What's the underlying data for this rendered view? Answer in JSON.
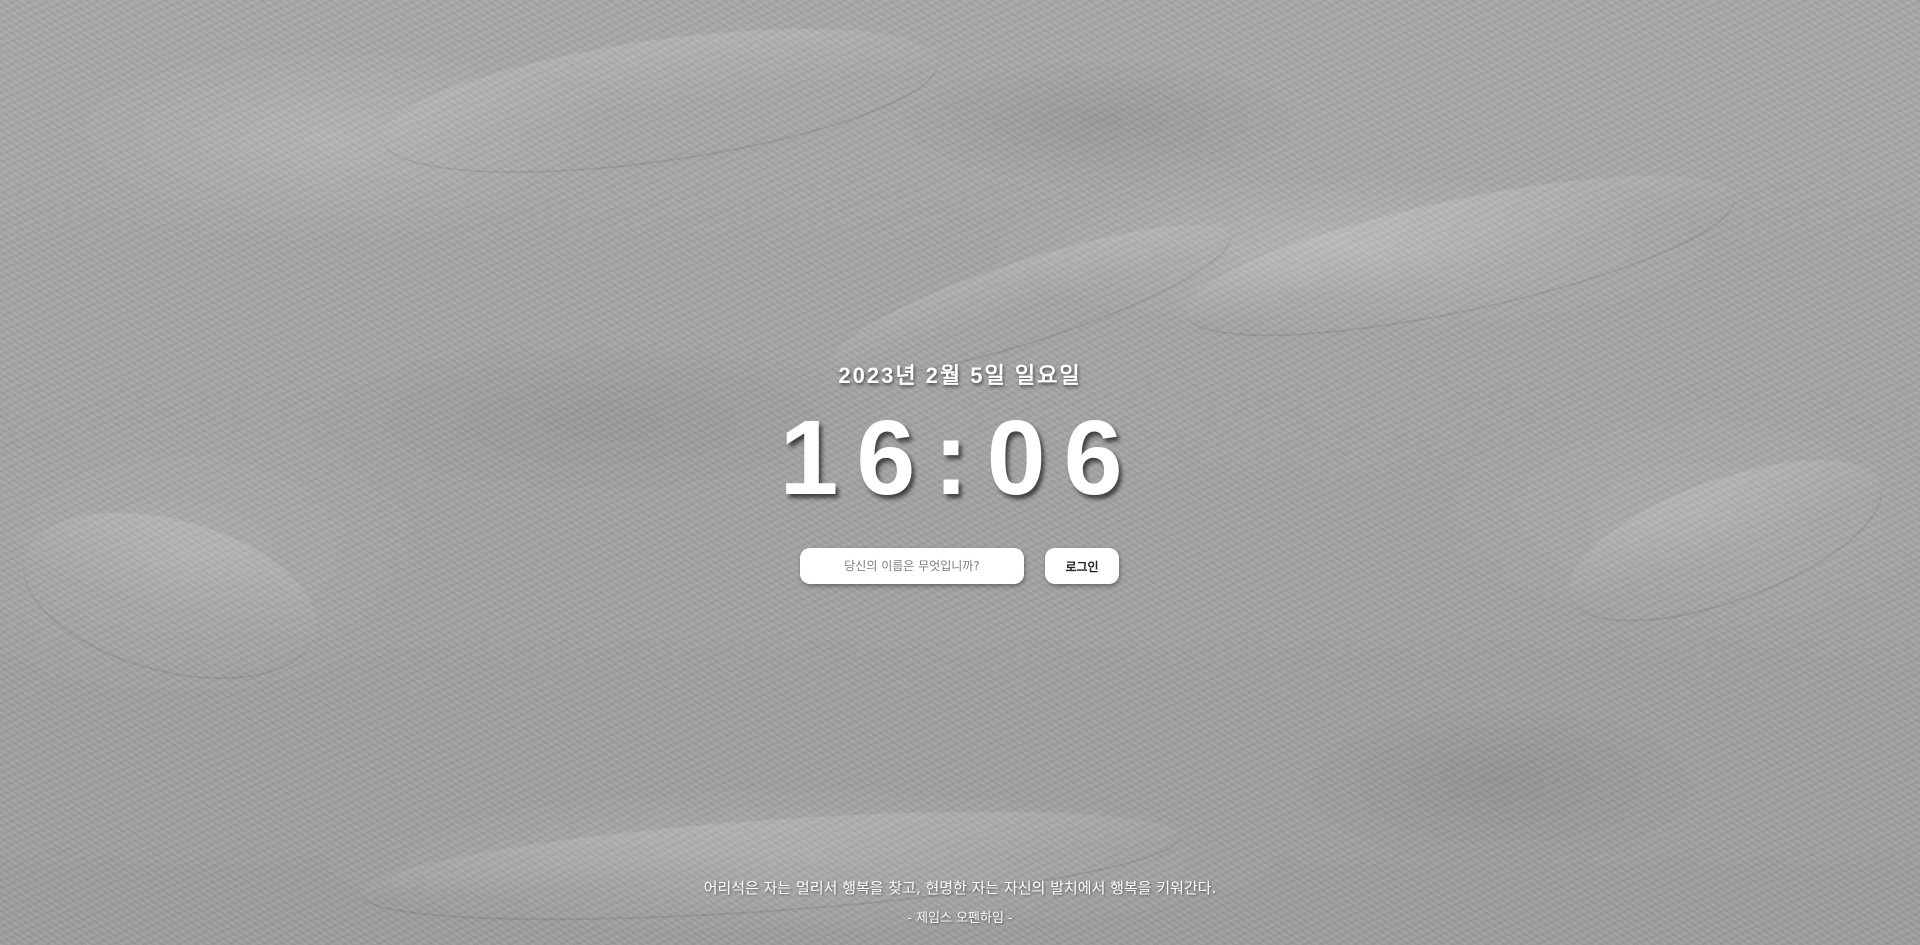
{
  "clock": {
    "date": "2023년 2월 5일 일요일",
    "time": "16:06"
  },
  "login": {
    "name_placeholder": "당신의 이름은 무엇입니까?",
    "button_label": "로그인"
  },
  "quote": {
    "text": "어리석은 자는 멀리서 행복을 찾고, 현명한 자는 자신의 발치에서 행복을 키워간다.",
    "author": "- 제임스 오펜하임 -"
  }
}
